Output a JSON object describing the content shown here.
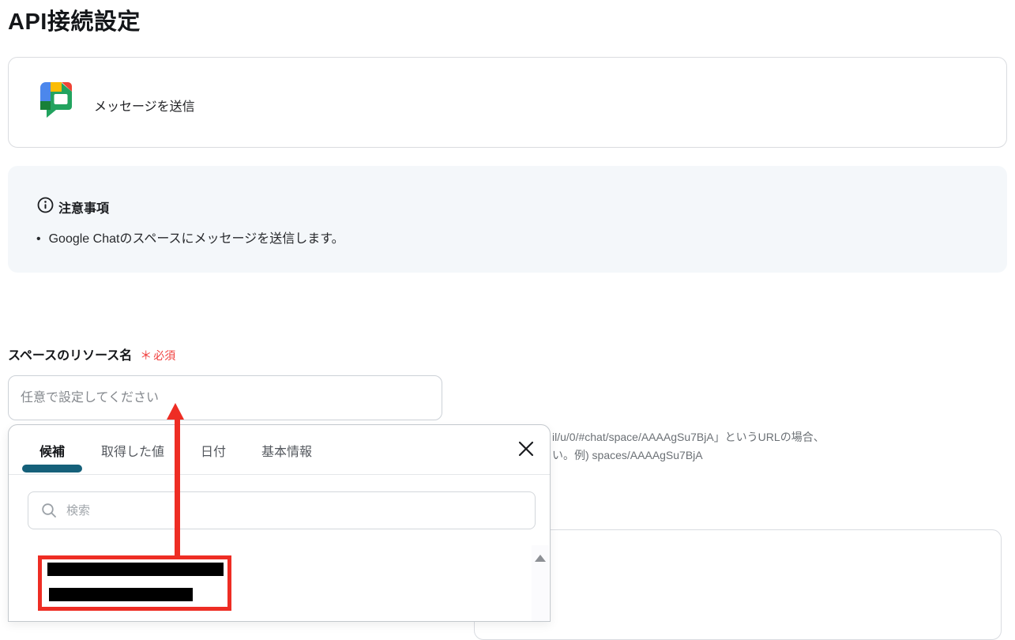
{
  "page": {
    "title": "API接続設定"
  },
  "service_card": {
    "label": "メッセージを送信",
    "icon": "google-chat"
  },
  "notice": {
    "icon": "info-circle",
    "title": "注意事項",
    "bullet": "•",
    "items": [
      "Google Chatのスペースにメッセージを送信します。"
    ]
  },
  "field": {
    "label": "スペースのリソース名",
    "required_mark": "＊",
    "required_label": "必須",
    "input_value": "",
    "input_placeholder": "任意で設定してください",
    "help_text_visible_line1": "il/u/0/#chat/space/AAAAgSu7BjA」というURLの場合、",
    "help_text_visible_line2": "い。例) spaces/AAAAgSu7BjA"
  },
  "suggestion_popup": {
    "tabs": [
      {
        "label": "候補",
        "active": true
      },
      {
        "label": "取得した値",
        "active": false
      },
      {
        "label": "日付",
        "active": false
      },
      {
        "label": "基本情報",
        "active": false
      }
    ],
    "search": {
      "value": "",
      "placeholder": "検索",
      "icon": "search"
    },
    "close_icon": "close-x",
    "scrollbar_up_arrow": true,
    "redacted_item_count": 2
  },
  "colors": {
    "active_tab_underline": "#15607a",
    "required_red": "#f03e3c",
    "notice_bg": "#f4f7fa",
    "annotation_red": "#ee2d24",
    "chat_icon_blue": "#4c87ec",
    "chat_icon_yellow": "#fbbc04",
    "chat_icon_red": "#ef4335",
    "chat_icon_green": "#22a35f",
    "chat_icon_dark_green": "#188038"
  }
}
